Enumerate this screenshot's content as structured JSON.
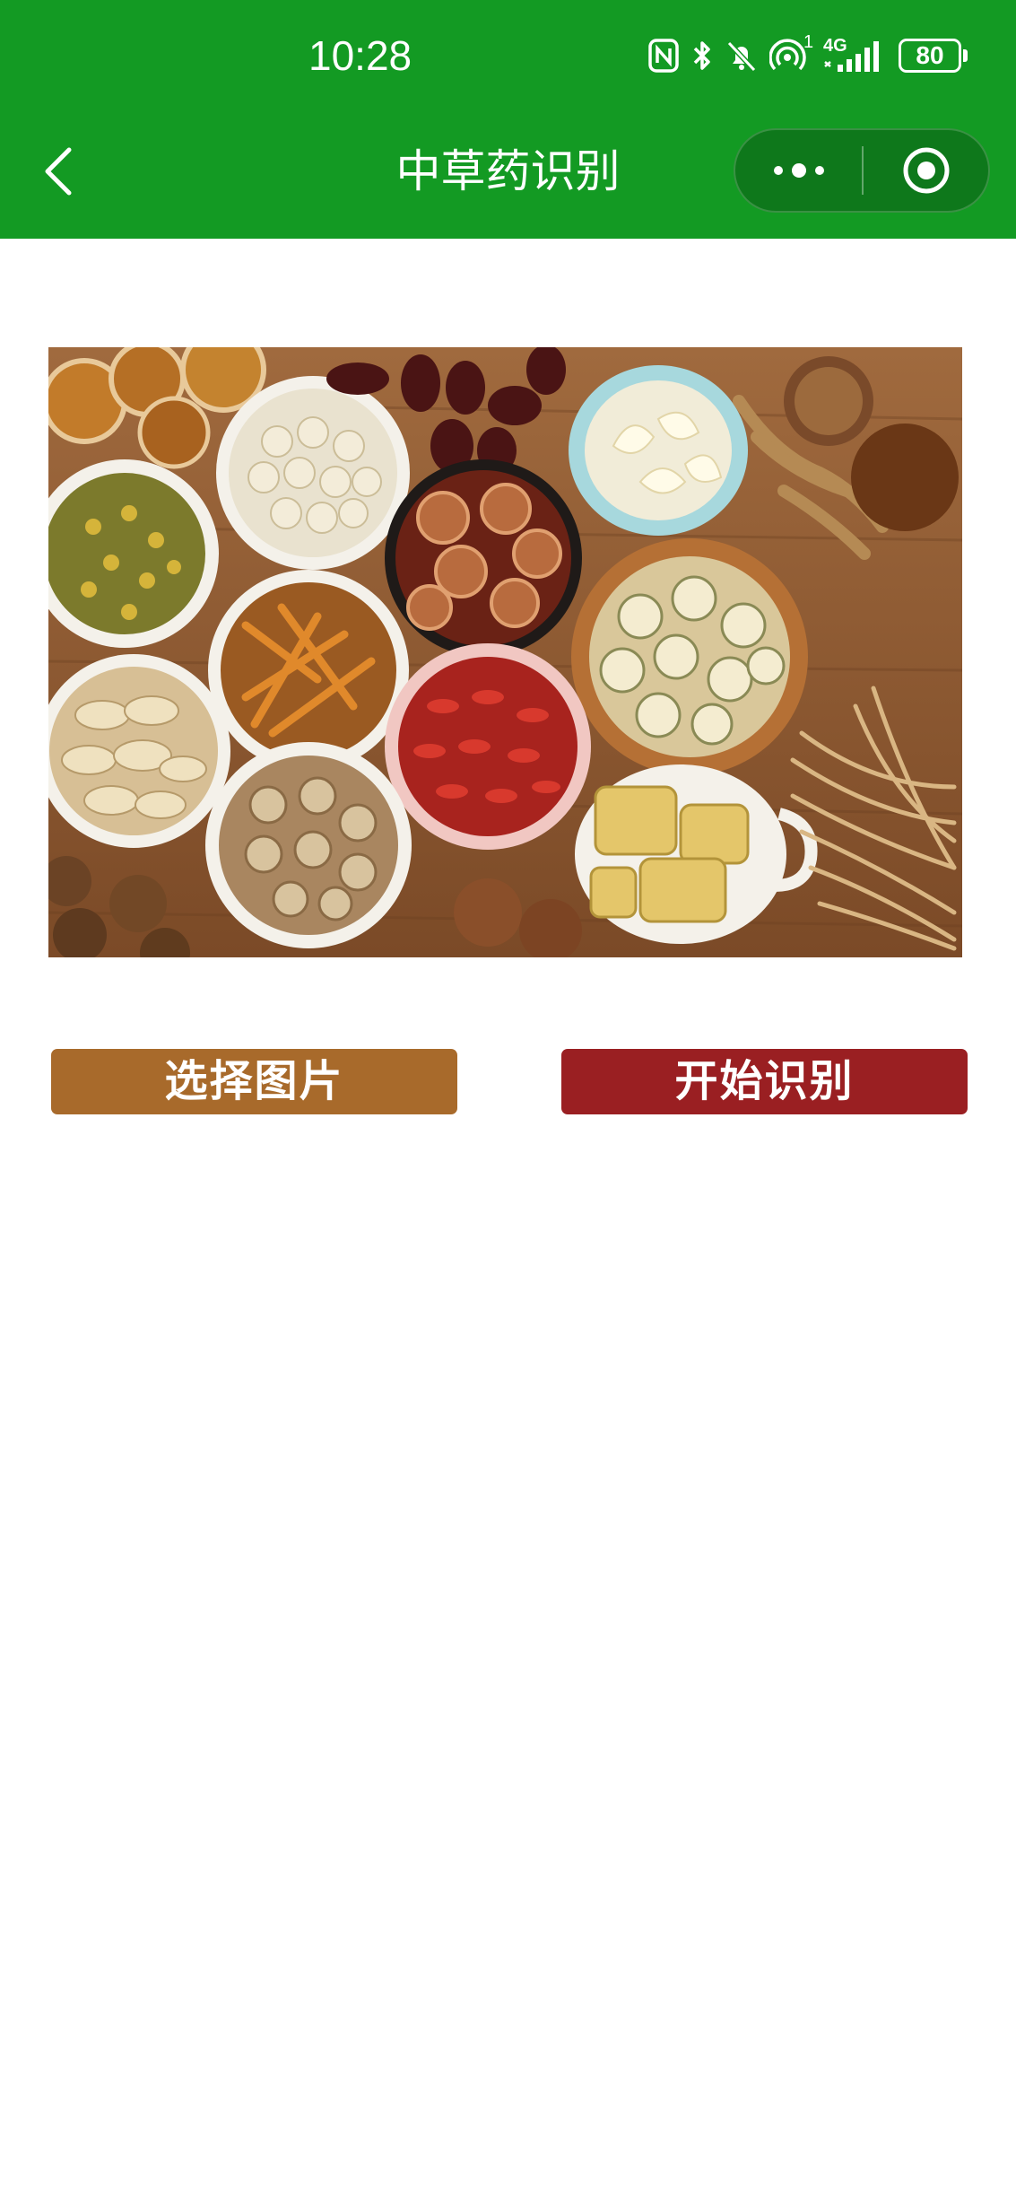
{
  "status_bar": {
    "time": "10:28",
    "signal_label": "4G",
    "hotspot_sup": "1",
    "battery": "80"
  },
  "nav": {
    "title": "中草药识别"
  },
  "image": {
    "description_icon": "herb-photo"
  },
  "buttons": {
    "select_label": "选择图片",
    "start_label": "开始识别"
  },
  "colors": {
    "header_bg": "#139a23",
    "select_btn": "#a86a2b",
    "start_btn": "#9a1f22"
  }
}
